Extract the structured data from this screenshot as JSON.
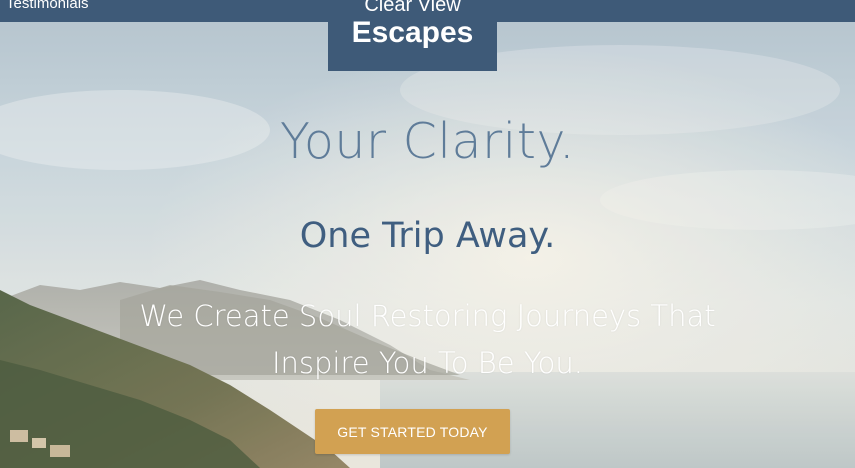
{
  "nav": {
    "testimonials_label": "Testimonials"
  },
  "logo": {
    "line1": "Clear View",
    "line2": "Escapes"
  },
  "hero": {
    "headline": "Your Clarity.",
    "subheadline": "One Trip Away.",
    "tagline_line1": "We Create Soul Restoring Journeys That",
    "tagline_line2": "Inspire You To Be You.",
    "cta_label": "GET STARTED TODAY"
  },
  "colors": {
    "brand_navy": "#3e5a78",
    "headline_blue": "#5f7c99",
    "subheadline_blue": "#3f5e80",
    "cta_gold": "#d2a152"
  }
}
